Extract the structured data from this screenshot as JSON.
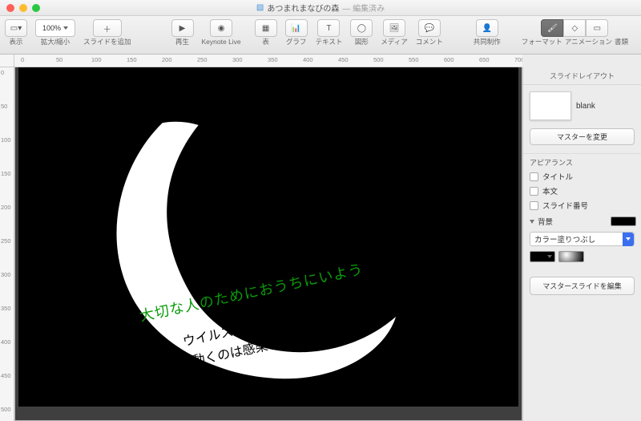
{
  "window": {
    "title": "あつまれまなびの森",
    "status": "編集済み"
  },
  "toolbar": {
    "view": "表示",
    "zoom_value": "100%",
    "zoom_label": "拡大/縮小",
    "add_slide": "スライドを追加",
    "play": "再生",
    "keynote_live": "Keynote Live",
    "table": "表",
    "chart": "グラフ",
    "text": "テキスト",
    "shape": "図形",
    "media": "メディア",
    "comment": "コメント",
    "collaborate": "共同制作",
    "format": "フォーマット",
    "animate": "アニメーション",
    "document": "書類"
  },
  "ruler": {
    "h": [
      "0",
      "50",
      "100",
      "150",
      "200",
      "250",
      "300",
      "350",
      "400",
      "450",
      "500",
      "550",
      "600",
      "650",
      "700"
    ],
    "v": [
      "0",
      "50",
      "100",
      "150",
      "200",
      "250",
      "300",
      "350",
      "400",
      "450",
      "500"
    ]
  },
  "slide": {
    "text_line1": "大切な人のためにおうちにいよう",
    "text_line2": "ウイルスは動かない",
    "text_line3": "動くのは感染者"
  },
  "inspector": {
    "header": "スライドレイアウト",
    "master_name": "blank",
    "change_master": "マスターを変更",
    "appearance": "アピアランス",
    "title_chk": "タイトル",
    "body_chk": "本文",
    "slidenum_chk": "スライド番号",
    "background": "背景",
    "fill_type": "カラー塗りつぶし",
    "edit_master": "マスタースライドを編集"
  },
  "colors": {
    "bg_fill": "#000000"
  }
}
